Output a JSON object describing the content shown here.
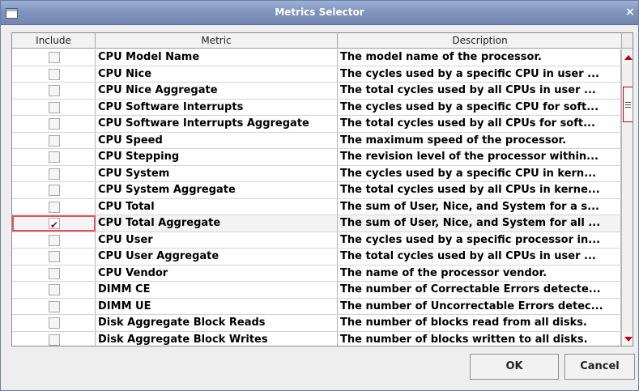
{
  "window": {
    "title": "Metrics Selector",
    "close_glyph": "×"
  },
  "table": {
    "columns": [
      "Include",
      "Metric",
      "Description"
    ],
    "rows": [
      {
        "include": false,
        "metric": "CPU Model Name",
        "description": "The model name of the processor."
      },
      {
        "include": false,
        "metric": "CPU Nice",
        "description": "The cycles used by a specific CPU in user ..."
      },
      {
        "include": false,
        "metric": "CPU Nice Aggregate",
        "description": "The total cycles used by all CPUs in user ..."
      },
      {
        "include": false,
        "metric": "CPU Software Interrupts",
        "description": "The cycles used by a specific CPU for soft..."
      },
      {
        "include": false,
        "metric": "CPU Software Interrupts Aggregate",
        "description": "The total cycles used by all CPUs for soft..."
      },
      {
        "include": false,
        "metric": "CPU Speed",
        "description": "The maximum speed of the processor."
      },
      {
        "include": false,
        "metric": "CPU Stepping",
        "description": "The revision level of the processor within..."
      },
      {
        "include": false,
        "metric": "CPU System",
        "description": "The cycles used by a specific CPU in kern..."
      },
      {
        "include": false,
        "metric": "CPU System Aggregate",
        "description": "The total cycles used by all CPUs in kerne..."
      },
      {
        "include": false,
        "metric": "CPU Total",
        "description": "The sum of User, Nice, and System for a s..."
      },
      {
        "include": true,
        "metric": "CPU Total Aggregate",
        "description": "The sum of User, Nice, and System for all ...",
        "selected": true
      },
      {
        "include": false,
        "metric": "CPU User",
        "description": "The cycles used by a specific processor in..."
      },
      {
        "include": false,
        "metric": "CPU User Aggregate",
        "description": "The total cycles used by all CPUs in user ..."
      },
      {
        "include": false,
        "metric": "CPU Vendor",
        "description": "The name of the processor vendor."
      },
      {
        "include": false,
        "metric": "DIMM CE",
        "description": "The number of Correctable Errors detecte..."
      },
      {
        "include": false,
        "metric": "DIMM UE",
        "description": "The number of Uncorrectable Errors detec..."
      },
      {
        "include": false,
        "metric": "Disk Aggregate Block Reads",
        "description": "The number of blocks read from all disks."
      },
      {
        "include": false,
        "metric": "Disk Aggregate Block Writes",
        "description": "The number of blocks written to all disks."
      }
    ]
  },
  "buttons": {
    "ok": "OK",
    "cancel": "Cancel"
  },
  "colors": {
    "accent": "#c00018",
    "titlebar": "#8194bc"
  },
  "icons": {
    "window": "window-icon",
    "close": "close-icon",
    "check": "checkmark-icon"
  }
}
